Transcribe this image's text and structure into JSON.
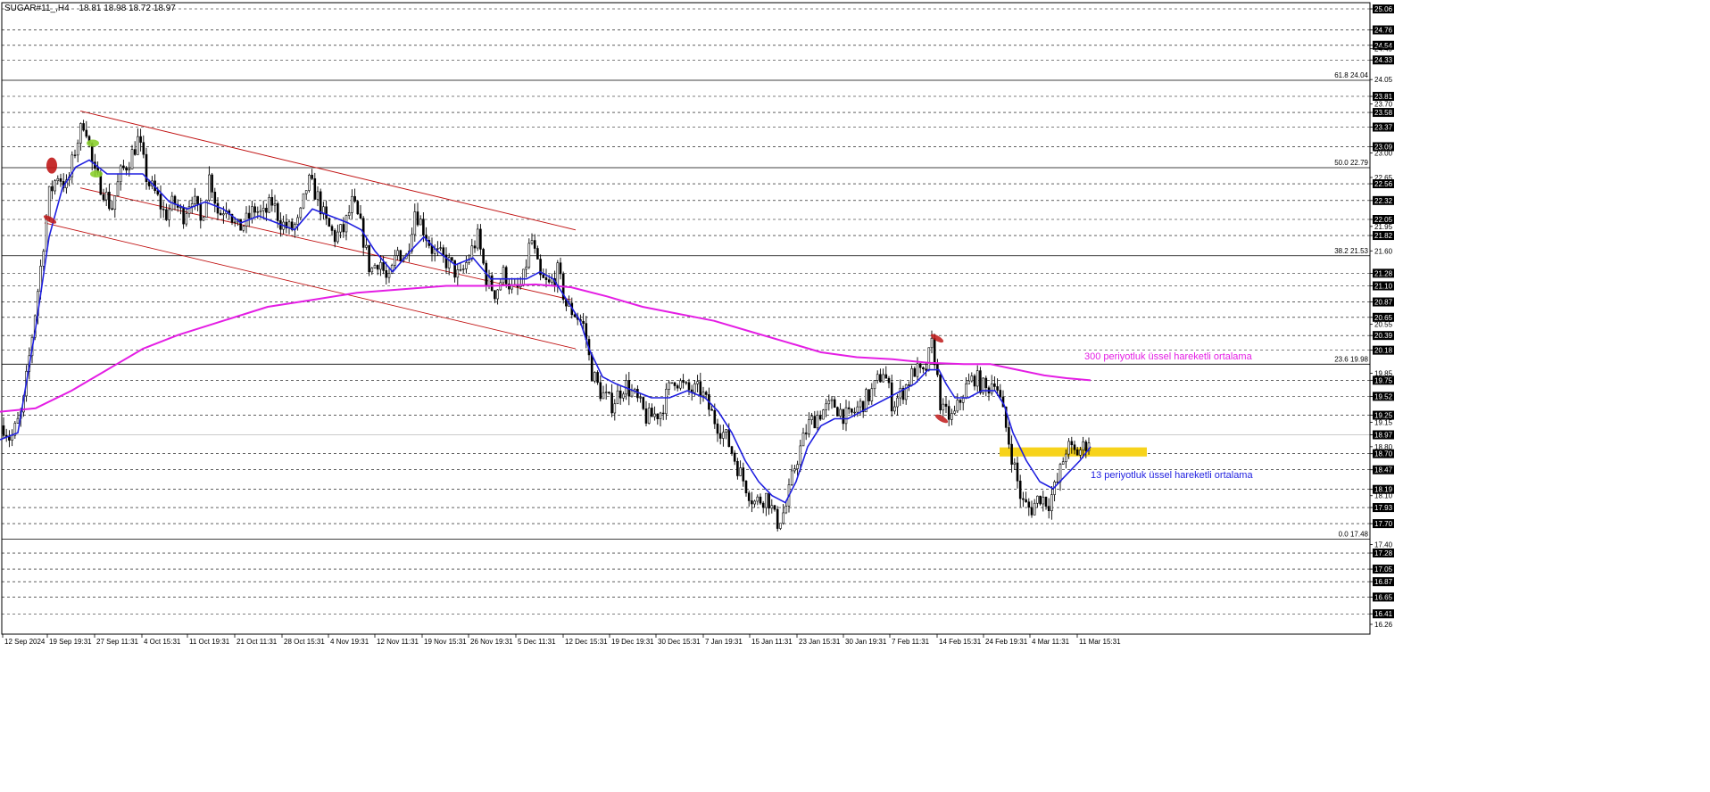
{
  "header": {
    "symbol": "SUGAR#11_,H4",
    "ohlc": "18.81 18.98 18.72 18.97"
  },
  "colors": {
    "background": "#ffffff",
    "grid": "#000000",
    "candle": "#000000",
    "ema13": "#1f1fe0",
    "ema300": "#e41ee4",
    "channel": "#c01010",
    "highlight": "#f7d31b",
    "price_box": "#000000"
  },
  "chart_data": {
    "type": "candlestick",
    "title": "",
    "xlabel": "",
    "ylabel": "",
    "ylim": [
      16.26,
      25.06
    ],
    "current_price": 18.97,
    "y_tick_labels": [
      25.06,
      24.76,
      24.54,
      24.49,
      24.33,
      24.05,
      23.81,
      23.7,
      23.58,
      23.37,
      23.09,
      23.0,
      22.65,
      22.56,
      22.32,
      22.05,
      21.95,
      21.82,
      21.6,
      21.28,
      21.1,
      20.87,
      20.65,
      20.55,
      20.39,
      20.18,
      19.85,
      19.75,
      19.52,
      19.15,
      19.25,
      18.97,
      18.8,
      18.7,
      18.47,
      18.1,
      18.19,
      17.93,
      17.7,
      17.4,
      17.28,
      17.05,
      16.87,
      16.65,
      16.41,
      16.26
    ],
    "boxed_labels": [
      25.06,
      24.76,
      24.54,
      24.33,
      23.81,
      23.58,
      23.37,
      23.09,
      22.56,
      22.32,
      22.05,
      21.82,
      21.28,
      21.1,
      20.87,
      20.65,
      20.39,
      20.18,
      19.75,
      19.52,
      19.25,
      18.97,
      18.7,
      18.47,
      18.19,
      17.93,
      17.7,
      17.28,
      17.05,
      16.87,
      16.65,
      16.41
    ],
    "dashed_levels": [
      25.06,
      24.76,
      24.54,
      24.33,
      23.81,
      23.58,
      23.37,
      23.09,
      22.56,
      22.32,
      22.05,
      21.82,
      21.28,
      21.1,
      20.87,
      20.65,
      20.39,
      20.18,
      19.75,
      19.52,
      19.25,
      18.7,
      18.47,
      18.19,
      17.93,
      17.7,
      17.28,
      17.05,
      16.87,
      16.65,
      16.41
    ],
    "fibonacci": [
      {
        "label": "61.8 24.04",
        "value": 24.04
      },
      {
        "label": "50.0 22.79",
        "value": 22.79
      },
      {
        "label": "38.2 21.53",
        "value": 21.53
      },
      {
        "label": "23.6 19.98",
        "value": 19.98
      },
      {
        "label": "0.0 17.48",
        "value": 17.48
      }
    ],
    "x_tick_labels": [
      "12 Sep 2024",
      "19 Sep 19:31",
      "27 Sep 11:31",
      "4 Oct 15:31",
      "11 Oct 19:31",
      "21 Oct 11:31",
      "28 Oct 15:31",
      "4 Nov 19:31",
      "12 Nov 11:31",
      "19 Nov 15:31",
      "26 Nov 19:31",
      "5 Dec 11:31",
      "12 Dec 15:31",
      "19 Dec 19:31",
      "30 Dec 15:31",
      "7 Jan 19:31",
      "15 Jan 11:31",
      "23 Jan 15:31",
      "30 Jan 19:31",
      "7 Feb 11:31",
      "14 Feb 15:31",
      "24 Feb 19:31",
      "4 Mar 11:31",
      "11 Mar 15:31"
    ],
    "price_path": [
      [
        0,
        19.2
      ],
      [
        12,
        18.9
      ],
      [
        25,
        19.3
      ],
      [
        35,
        20.3
      ],
      [
        45,
        21.3
      ],
      [
        55,
        22.4
      ],
      [
        65,
        22.7
      ],
      [
        75,
        22.5
      ],
      [
        85,
        23.1
      ],
      [
        95,
        23.5
      ],
      [
        105,
        22.7
      ],
      [
        115,
        22.5
      ],
      [
        125,
        22.2
      ],
      [
        135,
        22.7
      ],
      [
        145,
        22.9
      ],
      [
        155,
        23.2
      ],
      [
        165,
        22.6
      ],
      [
        175,
        22.4
      ],
      [
        185,
        22.1
      ],
      [
        195,
        22.3
      ],
      [
        205,
        22.1
      ],
      [
        215,
        22.4
      ],
      [
        225,
        22.0
      ],
      [
        235,
        22.7
      ],
      [
        245,
        22.1
      ],
      [
        255,
        22.3
      ],
      [
        265,
        21.9
      ],
      [
        275,
        22.0
      ],
      [
        285,
        22.2
      ],
      [
        295,
        22.1
      ],
      [
        305,
        22.3
      ],
      [
        315,
        22.0
      ],
      [
        325,
        21.9
      ],
      [
        335,
        22.0
      ],
      [
        345,
        22.6
      ],
      [
        355,
        22.4
      ],
      [
        365,
        22.0
      ],
      [
        375,
        21.8
      ],
      [
        385,
        21.9
      ],
      [
        395,
        22.3
      ],
      [
        405,
        21.9
      ],
      [
        415,
        21.3
      ],
      [
        425,
        21.5
      ],
      [
        435,
        21.1
      ],
      [
        445,
        21.6
      ],
      [
        455,
        21.5
      ],
      [
        465,
        22.2
      ],
      [
        475,
        21.9
      ],
      [
        485,
        21.6
      ],
      [
        495,
        21.5
      ],
      [
        505,
        21.4
      ],
      [
        515,
        21.2
      ],
      [
        525,
        21.5
      ],
      [
        535,
        21.8
      ],
      [
        545,
        21.2
      ],
      [
        555,
        21.0
      ],
      [
        565,
        21.3
      ],
      [
        575,
        21.0
      ],
      [
        585,
        21.1
      ],
      [
        595,
        21.8
      ],
      [
        605,
        21.2
      ],
      [
        615,
        21.1
      ],
      [
        625,
        21.3
      ],
      [
        635,
        20.8
      ],
      [
        645,
        20.7
      ],
      [
        655,
        20.5
      ],
      [
        662,
        19.9
      ],
      [
        672,
        19.6
      ],
      [
        685,
        19.4
      ],
      [
        700,
        19.7
      ],
      [
        712,
        19.5
      ],
      [
        725,
        19.2
      ],
      [
        740,
        19.3
      ],
      [
        755,
        19.8
      ],
      [
        770,
        19.6
      ],
      [
        785,
        19.6
      ],
      [
        800,
        19.2
      ],
      [
        815,
        18.9
      ],
      [
        830,
        18.4
      ],
      [
        845,
        18.0
      ],
      [
        860,
        18.1
      ],
      [
        870,
        17.7
      ],
      [
        880,
        17.9
      ],
      [
        890,
        18.5
      ],
      [
        905,
        19.1
      ],
      [
        920,
        19.3
      ],
      [
        935,
        19.4
      ],
      [
        950,
        19.2
      ],
      [
        965,
        19.4
      ],
      [
        978,
        19.6
      ],
      [
        990,
        19.9
      ],
      [
        1000,
        19.4
      ],
      [
        1012,
        19.6
      ],
      [
        1025,
        19.9
      ],
      [
        1035,
        19.8
      ],
      [
        1045,
        20.3
      ],
      [
        1055,
        19.3
      ],
      [
        1068,
        19.2
      ],
      [
        1080,
        19.6
      ],
      [
        1092,
        19.8
      ],
      [
        1105,
        19.6
      ],
      [
        1115,
        19.8
      ],
      [
        1125,
        19.2
      ],
      [
        1135,
        18.6
      ],
      [
        1145,
        18.0
      ],
      [
        1155,
        17.9
      ],
      [
        1165,
        18.1
      ],
      [
        1175,
        18.0
      ],
      [
        1185,
        18.3
      ],
      [
        1195,
        18.8
      ],
      [
        1205,
        18.7
      ],
      [
        1215,
        18.8
      ],
      [
        1222,
        18.97
      ]
    ],
    "ema13_path": [
      [
        0,
        18.9
      ],
      [
        20,
        19.0
      ],
      [
        40,
        20.5
      ],
      [
        55,
        21.8
      ],
      [
        70,
        22.5
      ],
      [
        85,
        22.8
      ],
      [
        100,
        22.9
      ],
      [
        120,
        22.7
      ],
      [
        140,
        22.7
      ],
      [
        160,
        22.7
      ],
      [
        175,
        22.5
      ],
      [
        190,
        22.3
      ],
      [
        210,
        22.2
      ],
      [
        230,
        22.3
      ],
      [
        250,
        22.2
      ],
      [
        270,
        22.0
      ],
      [
        290,
        22.1
      ],
      [
        310,
        22.0
      ],
      [
        330,
        21.9
      ],
      [
        350,
        22.2
      ],
      [
        370,
        22.1
      ],
      [
        390,
        22.0
      ],
      [
        405,
        21.9
      ],
      [
        420,
        21.6
      ],
      [
        440,
        21.3
      ],
      [
        460,
        21.6
      ],
      [
        475,
        21.8
      ],
      [
        490,
        21.6
      ],
      [
        510,
        21.4
      ],
      [
        530,
        21.5
      ],
      [
        550,
        21.2
      ],
      [
        570,
        21.2
      ],
      [
        590,
        21.2
      ],
      [
        605,
        21.3
      ],
      [
        620,
        21.2
      ],
      [
        635,
        20.9
      ],
      [
        650,
        20.6
      ],
      [
        660,
        20.2
      ],
      [
        675,
        19.8
      ],
      [
        690,
        19.7
      ],
      [
        710,
        19.6
      ],
      [
        730,
        19.5
      ],
      [
        750,
        19.5
      ],
      [
        770,
        19.6
      ],
      [
        790,
        19.5
      ],
      [
        805,
        19.3
      ],
      [
        820,
        19.0
      ],
      [
        835,
        18.6
      ],
      [
        850,
        18.3
      ],
      [
        865,
        18.1
      ],
      [
        880,
        18.0
      ],
      [
        892,
        18.3
      ],
      [
        905,
        18.8
      ],
      [
        920,
        19.1
      ],
      [
        935,
        19.2
      ],
      [
        950,
        19.2
      ],
      [
        965,
        19.3
      ],
      [
        980,
        19.4
      ],
      [
        995,
        19.5
      ],
      [
        1010,
        19.6
      ],
      [
        1025,
        19.7
      ],
      [
        1040,
        19.9
      ],
      [
        1052,
        19.9
      ],
      [
        1060,
        19.7
      ],
      [
        1070,
        19.5
      ],
      [
        1085,
        19.5
      ],
      [
        1100,
        19.6
      ],
      [
        1115,
        19.6
      ],
      [
        1125,
        19.4
      ],
      [
        1135,
        19.0
      ],
      [
        1150,
        18.6
      ],
      [
        1165,
        18.3
      ],
      [
        1180,
        18.2
      ],
      [
        1195,
        18.4
      ],
      [
        1210,
        18.6
      ],
      [
        1222,
        18.8
      ]
    ],
    "ema300_path": [
      [
        0,
        19.3
      ],
      [
        40,
        19.35
      ],
      [
        80,
        19.6
      ],
      [
        120,
        19.9
      ],
      [
        160,
        20.2
      ],
      [
        200,
        20.4
      ],
      [
        250,
        20.6
      ],
      [
        300,
        20.8
      ],
      [
        350,
        20.9
      ],
      [
        400,
        21.0
      ],
      [
        450,
        21.05
      ],
      [
        500,
        21.1
      ],
      [
        550,
        21.1
      ],
      [
        600,
        21.12
      ],
      [
        640,
        21.08
      ],
      [
        680,
        20.95
      ],
      [
        720,
        20.8
      ],
      [
        760,
        20.7
      ],
      [
        800,
        20.6
      ],
      [
        840,
        20.45
      ],
      [
        880,
        20.3
      ],
      [
        920,
        20.15
      ],
      [
        960,
        20.08
      ],
      [
        1000,
        20.05
      ],
      [
        1040,
        20.0
      ],
      [
        1080,
        19.98
      ],
      [
        1110,
        19.98
      ],
      [
        1140,
        19.9
      ],
      [
        1170,
        19.82
      ],
      [
        1195,
        19.78
      ],
      [
        1222,
        19.75
      ]
    ],
    "channel_lines": [
      {
        "from": [
          90,
          23.6
        ],
        "to": [
          645,
          21.9
        ]
      },
      {
        "from": [
          50,
          22.0
        ],
        "to": [
          645,
          20.2
        ]
      },
      {
        "from": [
          90,
          22.5
        ],
        "to": [
          640,
          20.9
        ]
      }
    ],
    "highlight_zone": {
      "x_from": 1120,
      "x_to": 1285,
      "y_low": 18.66,
      "y_high": 18.79
    },
    "markers": [
      {
        "kind": "red-blob",
        "x": 58,
        "y": 22.82
      },
      {
        "kind": "red-mark",
        "x": 56,
        "y": 22.05
      },
      {
        "kind": "green-blob",
        "x": 104,
        "y": 23.14
      },
      {
        "kind": "green-blob",
        "x": 108,
        "y": 22.7
      },
      {
        "kind": "red-mark",
        "x": 1050,
        "y": 20.35
      },
      {
        "kind": "red-mark",
        "x": 1055,
        "y": 19.2
      }
    ],
    "annotations": [
      {
        "text": "300 periyotluk üssel hareketli ortalama",
        "x": 1215,
        "y": 20.05,
        "color": "#e41ee4"
      },
      {
        "text": "13 periyotluk üssel hareketli ortalama",
        "x": 1222,
        "y": 18.35,
        "color": "#1f1fe0"
      }
    ]
  }
}
